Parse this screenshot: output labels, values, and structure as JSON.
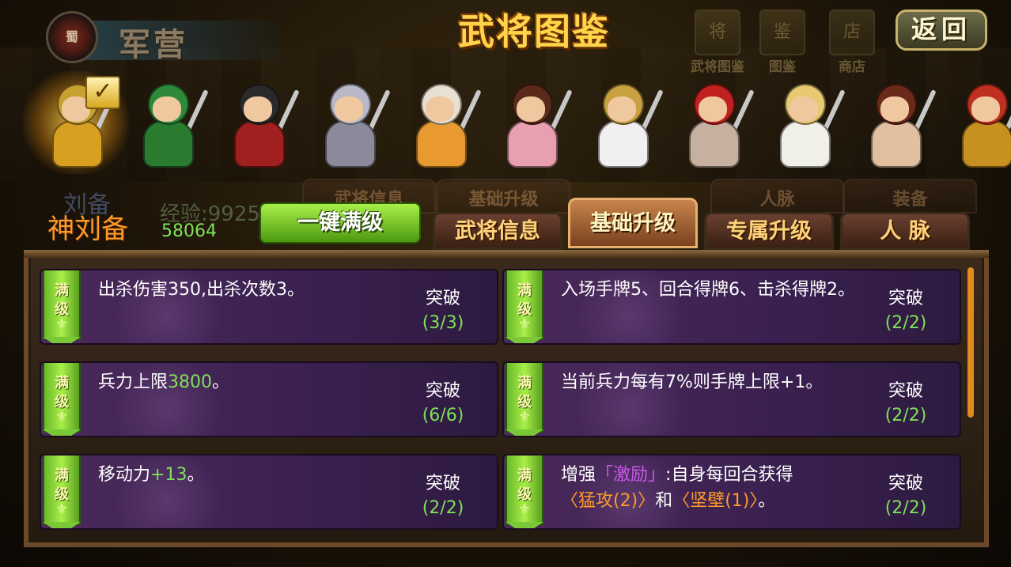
{
  "header": {
    "camp_emblem": "蜀",
    "camp_title": "军营",
    "main_title": "武将图鉴",
    "icons": [
      {
        "label": "武将图鉴",
        "glyph": "将"
      },
      {
        "label": "图鉴",
        "glyph": "鉴"
      },
      {
        "label": "商店",
        "glyph": "店"
      }
    ],
    "back_label": "返回"
  },
  "heroes": [
    {
      "name": "hero-1",
      "helmet": "#c8a030",
      "armor": "#d8a020"
    },
    {
      "name": "hero-2",
      "helmet": "#2e8a3a",
      "armor": "#2a7a30"
    },
    {
      "name": "hero-3",
      "helmet": "#2a2a2a",
      "armor": "#a02020"
    },
    {
      "name": "hero-4",
      "helmet": "#b8b8c8",
      "armor": "#8a8a9a"
    },
    {
      "name": "hero-5",
      "helmet": "#e8e0d0",
      "armor": "#e89a30"
    },
    {
      "name": "hero-6",
      "helmet": "#5a2a1a",
      "armor": "#e8a0b0"
    },
    {
      "name": "hero-7",
      "helmet": "#c8a040",
      "armor": "#f0f0f0"
    },
    {
      "name": "hero-8",
      "helmet": "#c02020",
      "armor": "#c8b0a0"
    },
    {
      "name": "hero-9",
      "helmet": "#e8c870",
      "armor": "#f0f0e8"
    },
    {
      "name": "hero-10",
      "helmet": "#6a2a1a",
      "armor": "#e0c0a0"
    },
    {
      "name": "hero-11",
      "helmet": "#c03020",
      "armor": "#c89020"
    }
  ],
  "general": {
    "name_ghost": "刘备",
    "name": "神刘备",
    "exp_ghost": "经验:9925",
    "exp_value": "58064"
  },
  "max_all_button": "一键满级",
  "ghost_tabs": [
    "武将信息",
    "基础升级",
    "人脉",
    "装备"
  ],
  "tabs": [
    {
      "label": "武将信息",
      "active": false
    },
    {
      "label": "基础升级",
      "active": true
    },
    {
      "label": "专属升级",
      "active": false
    },
    {
      "label": "人 脉",
      "active": false
    }
  ],
  "ribbon_label": "满级",
  "break_label": "突破",
  "cards": [
    {
      "desc": [
        {
          "t": "出杀伤害350,出杀次数3。"
        }
      ],
      "count": "(3/3)"
    },
    {
      "desc": [
        {
          "t": "入场手牌5、回合得牌6、击杀得牌2。"
        }
      ],
      "count": "(2/2)"
    },
    {
      "desc": [
        {
          "t": "兵力上限"
        },
        {
          "t": "3800",
          "c": "green"
        },
        {
          "t": "。"
        }
      ],
      "count": "(6/6)"
    },
    {
      "desc": [
        {
          "t": "当前兵力每有7%则手牌上限+1。"
        }
      ],
      "count": "(2/2)"
    },
    {
      "desc": [
        {
          "t": "移动力"
        },
        {
          "t": "+13",
          "c": "green"
        },
        {
          "t": "。"
        }
      ],
      "count": "(2/2)"
    },
    {
      "desc": [
        {
          "t": "增强"
        },
        {
          "t": "「激励」",
          "c": "purple"
        },
        {
          "t": ":自身每回合获得"
        },
        {
          "t": "〈猛攻(2)〉",
          "c": "orange"
        },
        {
          "t": "和"
        },
        {
          "t": "〈坚壁(1)〉",
          "c": "orange"
        },
        {
          "t": "。"
        }
      ],
      "count": "(2/2)"
    }
  ]
}
